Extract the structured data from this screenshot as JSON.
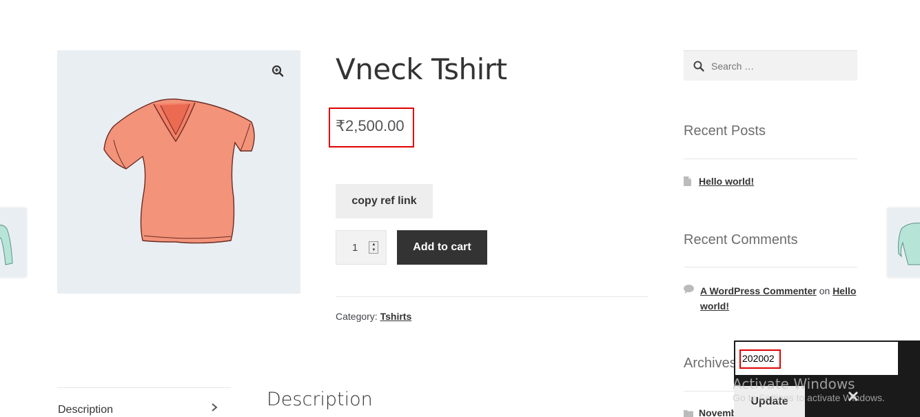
{
  "product": {
    "title": "Vneck Tshirt",
    "price": "₹2,500.00",
    "copy_ref_label": "copy ref link",
    "quantity": "1",
    "add_to_cart_label": "Add to cart",
    "category_label": "Category:",
    "category_value": "Tshirts",
    "shirt_color": "#f2937a"
  },
  "tabs": {
    "description_tab": "Description",
    "description_heading": "Description"
  },
  "sidebar": {
    "search_placeholder": "Search …",
    "recent_posts_title": "Recent Posts",
    "recent_post_item": "Hello world!",
    "recent_comments_title": "Recent Comments",
    "comment_author": "A WordPress Commenter",
    "comment_on": "on",
    "comment_post": "Hello world!",
    "archives_title": "Archives",
    "archive_item_partial": "Novemb"
  },
  "overlay": {
    "input_value": "202002",
    "update_label": "Update",
    "activate_title": "Activate Windows",
    "activate_subtitle": "Go to Settings to activate Windows."
  },
  "colors": {
    "highlight_border": "#e00000",
    "cart_button_bg": "#333333",
    "gallery_bg": "#e9eef2"
  }
}
